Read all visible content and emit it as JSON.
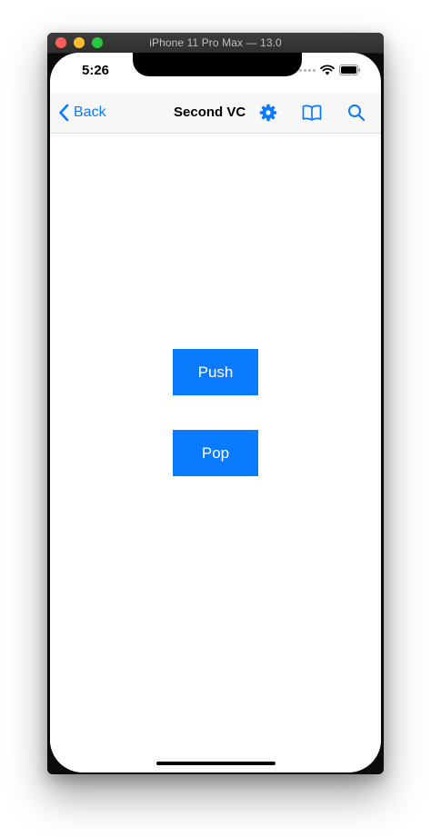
{
  "simulator": {
    "window_title": "iPhone 11 Pro Max — 13.0"
  },
  "status_bar": {
    "time": "5:26"
  },
  "nav_bar": {
    "back_label": "Back",
    "title": "Second VC",
    "icons": [
      "gear-icon",
      "book-icon",
      "search-icon"
    ]
  },
  "main": {
    "push_label": "Push",
    "pop_label": "Pop"
  },
  "colors": {
    "accent": "#0a7aff",
    "nav_background": "#f7f7f7",
    "screen_background": "#ffffff"
  }
}
